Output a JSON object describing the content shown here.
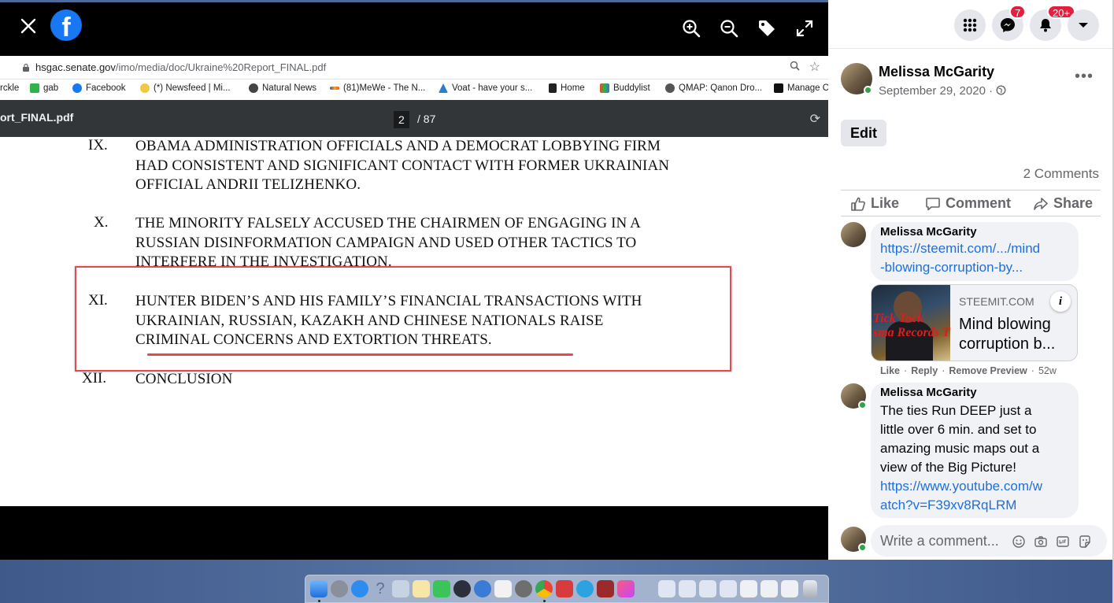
{
  "viewer": {
    "fb_logo": "f",
    "icons": [
      "close-icon",
      "zoom-in-icon",
      "zoom-out-icon",
      "tag-icon",
      "fullscreen-icon"
    ]
  },
  "browser": {
    "url_host": "hsgac.senate.gov",
    "url_path": "/imo/media/doc/Ukraine%20Report_FINAL.pdf",
    "bookmarks": [
      "rckle",
      "gab",
      "Facebook",
      "(*) Newsfeed | Mi...",
      "Natural News",
      "(81)MeWe - The N...",
      "Voat - have your s...",
      "Home",
      "Buddylist",
      "QMAP: Qanon Dro...",
      "Manage C"
    ],
    "pdf_filename": "ort_FINAL.pdf",
    "pdf_page": "2",
    "pdf_total": "/ 87"
  },
  "pdf": {
    "sections": [
      {
        "num": "IX.",
        "lines": [
          "OBAMA ADMINISTRATION OFFICIALS AND A DEMOCRAT LOBBYING FIRM",
          "HAD CONSISTENT AND SIGNIFICANT CONTACT WITH FORMER UKRAINIAN",
          "OFFICIAL ANDRII TELIZHENKO."
        ]
      },
      {
        "num": "X.",
        "lines": [
          "THE MINORITY FALSELY ACCUSED THE CHAIRMEN OF ENGAGING IN A",
          "RUSSIAN DISINFORMATION CAMPAIGN AND USED OTHER TACTICS TO",
          "INTERFERE IN THE INVESTIGATION."
        ]
      },
      {
        "num": "XI.",
        "lines": [
          "HUNTER BIDEN’S AND HIS FAMILY’S FINANCIAL TRANSACTIONS WITH",
          "UKRAINIAN, RUSSIAN, KAZAKH AND CHINESE NATIONALS RAISE",
          "CRIMINAL CONCERNS AND EXTORTION THREATS."
        ]
      },
      {
        "num": "XII.",
        "lines": [
          "CONCLUSION"
        ]
      }
    ]
  },
  "header": {
    "messenger_badge": "7",
    "notifications_badge": "20+"
  },
  "post": {
    "author": "Melissa McGarity",
    "date": "September 29, 2020 · ",
    "edit_label": "Edit",
    "comment_count": "2 Comments",
    "actions": {
      "like": "Like",
      "comment": "Comment",
      "share": "Share"
    }
  },
  "comments": [
    {
      "name": "Melissa McGarity",
      "link_lines": [
        "https://steemit.com/.../mind",
        "-blowing-corruption-by..."
      ],
      "preview": {
        "source": "STEEMIT.COM",
        "title": "Mind blowing corruption b...",
        "image_text_1": "Tick Tock",
        "image_text_2": "sma Records T"
      },
      "meta": {
        "like": "Like",
        "reply": "Reply",
        "remove_preview": "Remove Preview",
        "age": "52w"
      }
    },
    {
      "name": "Melissa McGarity",
      "text_lines": [
        "The ties Run DEEP just a",
        "little over 6 min. and set to",
        "amazing music maps out a",
        "view of the Big Picture!"
      ],
      "link_lines": [
        "https://www.youtube.com/w",
        "atch?v=F39xv8RqLRM"
      ]
    }
  ],
  "composer": {
    "placeholder": "Write a comment..."
  },
  "colors": {
    "facebook_blue": "#1877f2",
    "link": "#216fdb",
    "highlight_red": "#e5484d",
    "badge_red": "#e41e3f",
    "online_green": "#31a24c"
  }
}
